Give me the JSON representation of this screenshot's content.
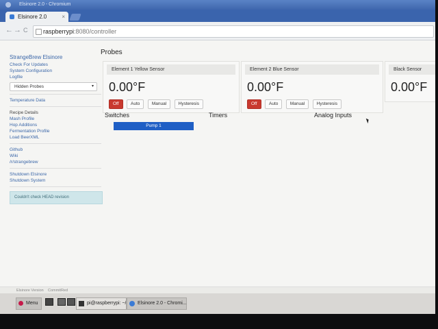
{
  "window": {
    "title": "Elsinore 2.0 - Chromium",
    "tab_label": "Elsinore 2.0",
    "tab_close": "×",
    "url_host": "raspberrypi",
    "url_rest": ":8080/controller",
    "nav_back": "←",
    "nav_forward": "→",
    "nav_reload": "C"
  },
  "sidebar": {
    "title": "StrangeBrew Elsinore",
    "links_top": [
      "Check For Updates",
      "System Configuration",
      "Logfile"
    ],
    "select_value": "Hidden Probes",
    "select_caret": "▾",
    "temperature_data": "Temperature Data",
    "recipe_details": "Recipe Details",
    "recipe_links": [
      "Mash Profile",
      "Hop Additions",
      "Fermentation Profile",
      "Load BeerXML"
    ],
    "external_links": [
      "Github",
      "Wiki",
      "/r/strangebrew"
    ],
    "shutdown_links": [
      "Shutdown Elsinore",
      "Shutdown System"
    ],
    "alert": "Couldn't check HEAD revision"
  },
  "probes": {
    "heading": "Probes",
    "cards": [
      {
        "name": "Element 1 Yellow Sensor",
        "temp": "0.00°F"
      },
      {
        "name": "Element 2 Blue Sensor",
        "temp": "0.00°F"
      },
      {
        "name": "Black Sensor",
        "temp": "0.00°F"
      }
    ],
    "buttons": {
      "off": "Off",
      "auto": "Auto",
      "manual": "Manual",
      "hysteresis": "Hysteresis"
    }
  },
  "switches": {
    "heading": "Switches",
    "pump_label": "Pump 1"
  },
  "timers": {
    "heading": "Timers"
  },
  "analog": {
    "heading": "Analog Inputs"
  },
  "footer": {
    "version": "Elsinore Version",
    "commit": "CommitRed"
  },
  "taskbar": {
    "menu": "Menu",
    "terminal": "pi@raspberrypi: ~/ho...",
    "browser": "Elsinore 2.0 - Chromi..."
  },
  "colors": {
    "accent": "#3a66a8",
    "off_button": "#c9392f",
    "pump_button": "#1f5fc5"
  }
}
